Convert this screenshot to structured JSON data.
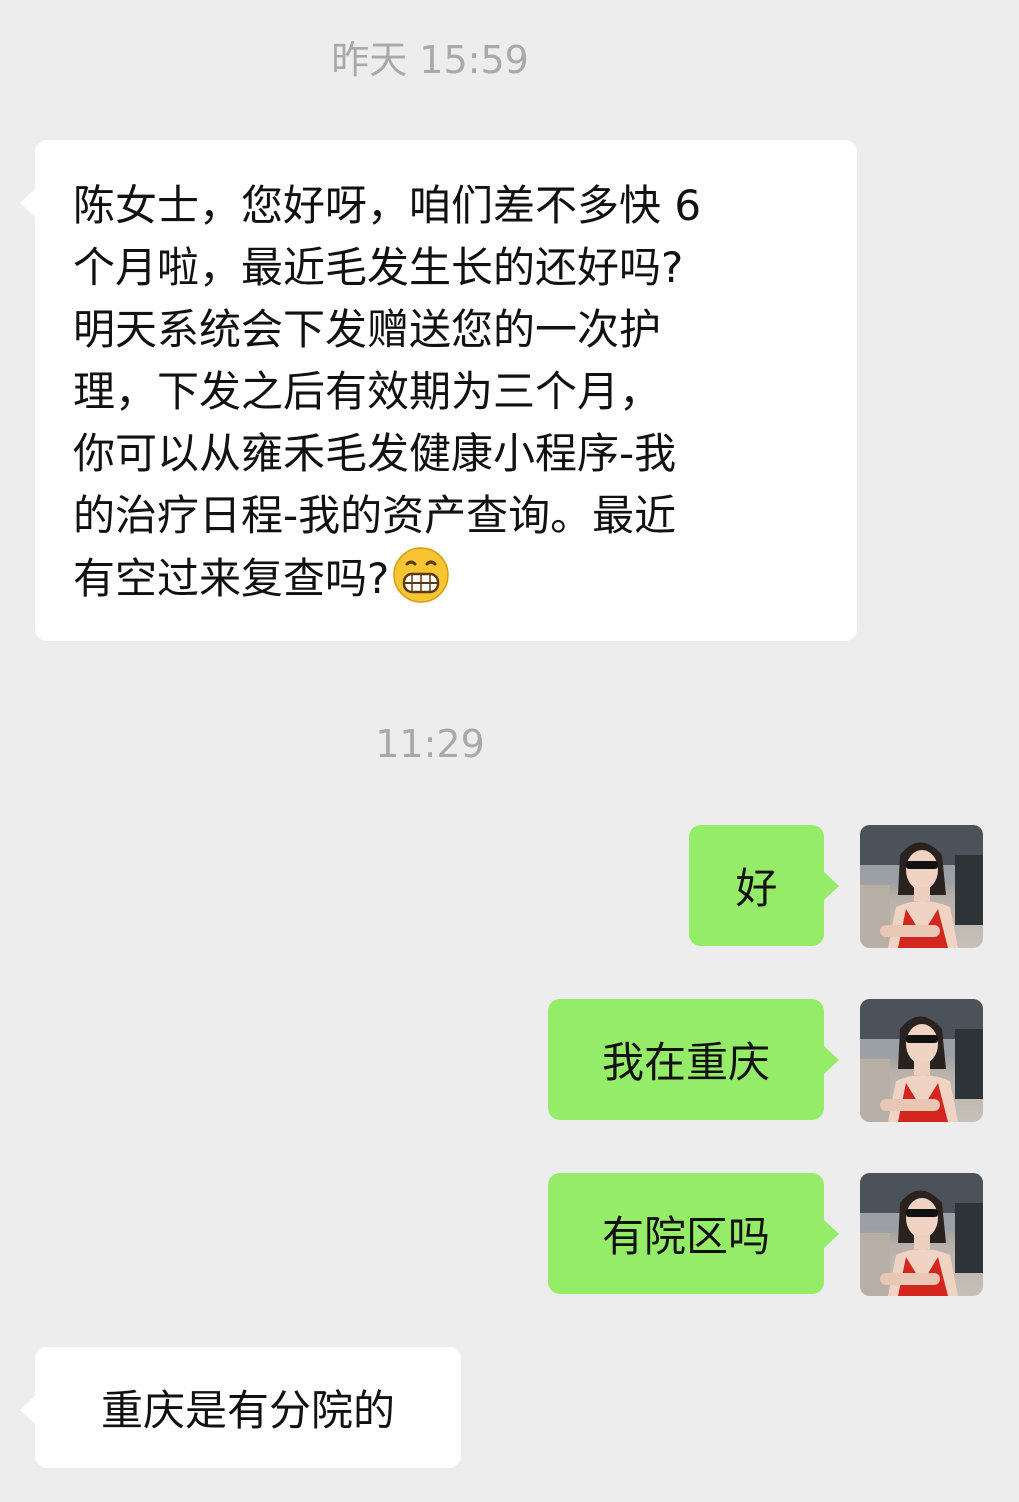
{
  "chat": {
    "timestamp1": "昨天 15:59",
    "message1_lines": [
      "陈女士，您好呀，咱们差不多快 6",
      "个月啦，最近毛发生长的还好吗?",
      "明天系统会下发赠送您的一次护",
      "理，下发之后有效期为三个月，",
      "你可以从雍禾毛发健康小程序-我",
      "的治疗日程-我的资产查询。最近",
      "有空过来复查吗?"
    ],
    "message1_emoji": "grinning-face-emoji",
    "timestamp2": "11:29",
    "message2": "好",
    "message3": "我在重庆",
    "message4": "有院区吗",
    "message5": "重庆是有分院的"
  },
  "colors": {
    "background": "#ededed",
    "incoming_bubble": "#ffffff",
    "outgoing_bubble": "#95ec69",
    "timestamp_text": "#a9a9a9"
  }
}
